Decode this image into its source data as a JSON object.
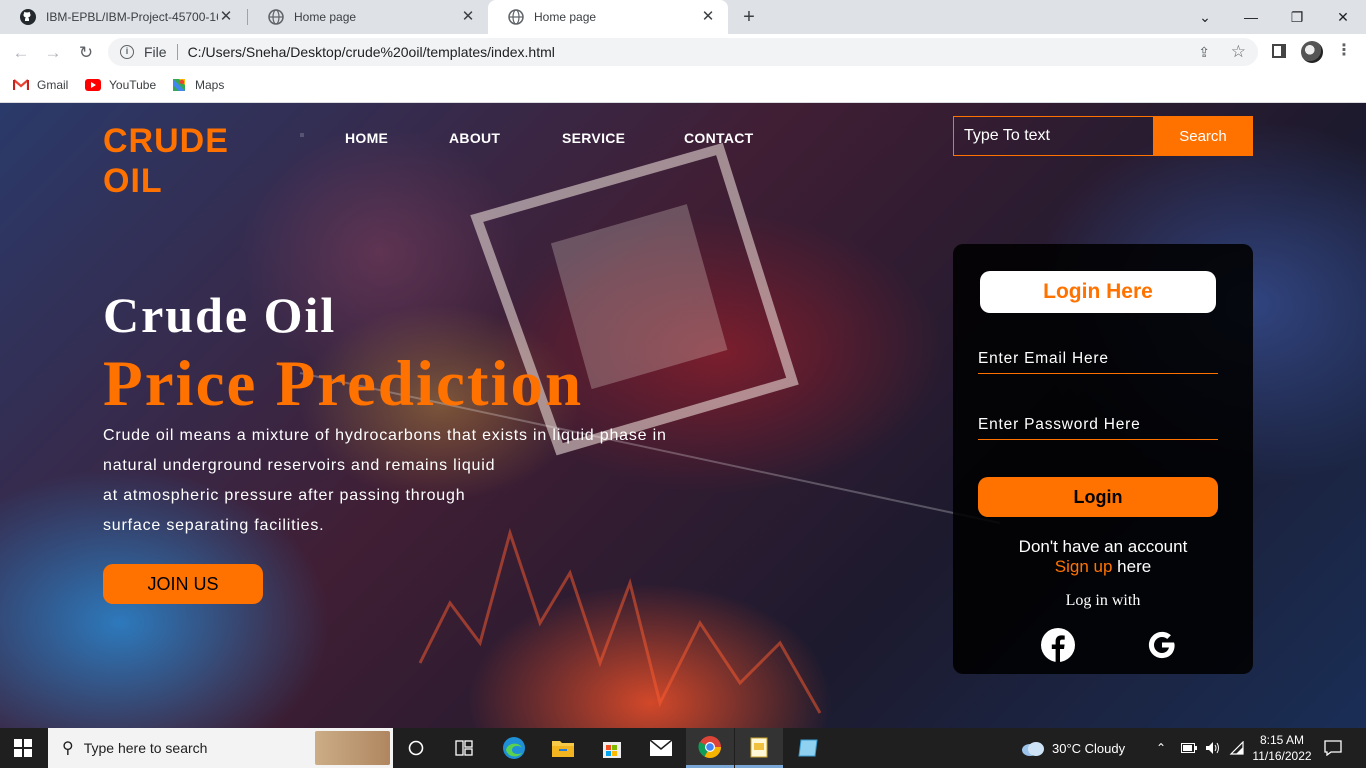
{
  "browser": {
    "tabs": [
      {
        "title": "IBM-EPBL/IBM-Project-45700-16",
        "favicon": "github-icon",
        "active": false
      },
      {
        "title": "Home page",
        "favicon": "globe-icon",
        "active": false
      },
      {
        "title": "Home page",
        "favicon": "globe-icon",
        "active": true
      }
    ],
    "address": {
      "prefix": "File",
      "url": "C:/Users/Sneha/Desktop/crude%20oil/templates/index.html"
    },
    "bookmarks": [
      {
        "label": "Gmail",
        "icon": "gmail-icon"
      },
      {
        "label": "YouTube",
        "icon": "youtube-icon"
      },
      {
        "label": "Maps",
        "icon": "maps-icon"
      }
    ]
  },
  "page": {
    "brand": "CRUDE OIL",
    "nav": [
      "HOME",
      "ABOUT",
      "SERVICE",
      "CONTACT"
    ],
    "search": {
      "placeholder": "Type To text",
      "button": "Search"
    },
    "hero": {
      "title": "Crude Oil",
      "subtitle": "Price Prediction",
      "paragraph_lines": [
        "Crude oil means a mixture of hydrocarbons that exists in liquid phase in",
        "natural underground reservoirs and remains liquid",
        "at atmospheric pressure after passing through",
        "surface separating facilities."
      ],
      "join_button": "JOIN US"
    },
    "login": {
      "title": "Login Here",
      "email_placeholder": "Enter Email Here",
      "password_placeholder": "Enter Password Here",
      "button": "Login",
      "no_account": "Don't have an account",
      "signup_link": "Sign up",
      "signup_suffix": " here",
      "login_with": "Log in with",
      "social": [
        "facebook-icon",
        "google-icon"
      ]
    },
    "accent_color": "#ff7200"
  },
  "taskbar": {
    "search_placeholder": "Type here to search",
    "weather": "30°C  Cloudy",
    "time": "8:15 AM",
    "date": "11/16/2022"
  }
}
